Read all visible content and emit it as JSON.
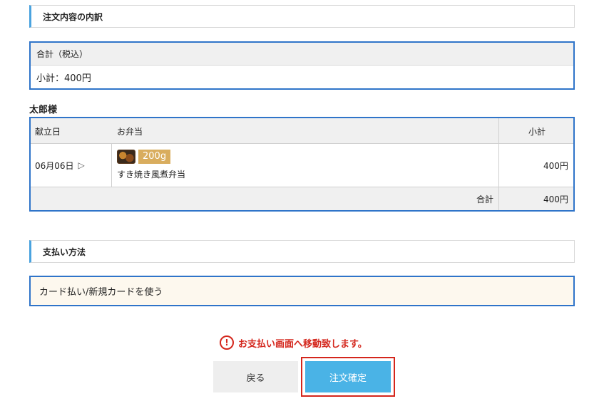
{
  "breakdown": {
    "heading": "注文内容の内訳"
  },
  "total": {
    "label": "合計（税込）",
    "subtotal": "小計：400円"
  },
  "customer": {
    "name": "太郎様"
  },
  "order_table": {
    "columns": [
      "献立日",
      "お弁当",
      "小計"
    ],
    "rows": [
      {
        "date": "06月06日",
        "date_arrow": "▷",
        "weight": "200g",
        "item": "すき焼き風煮弁当",
        "subtotal": "400円"
      }
    ],
    "footer": {
      "label": "合計",
      "value": "400円"
    }
  },
  "payment": {
    "heading": "支払い方法",
    "method": "カード払い/新規カードを使う"
  },
  "notice": {
    "icon": "!",
    "text": "お支払い画面へ移動致します。"
  },
  "buttons": {
    "back": "戻る",
    "confirm": "注文確定"
  },
  "colors": {
    "accent_blue": "#2f74c9",
    "button_blue": "#4ab3e6",
    "alert_red": "#d4261c",
    "badge_gold": "#d9ad5e"
  }
}
